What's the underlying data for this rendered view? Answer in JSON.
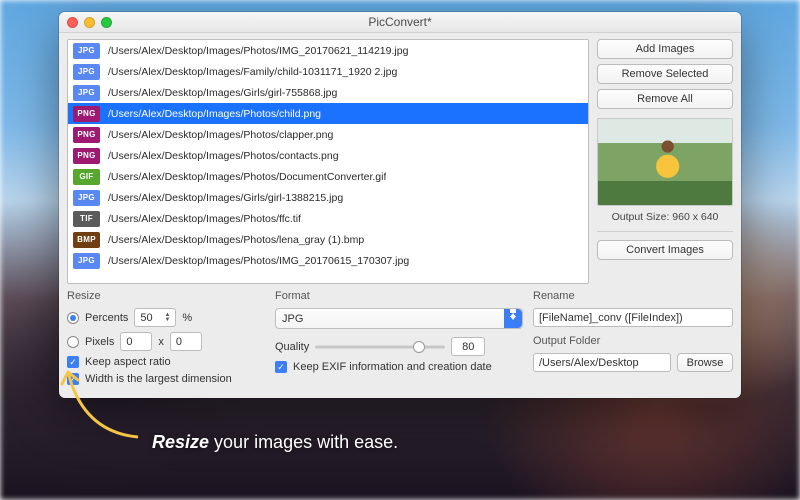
{
  "window": {
    "title": "PicConvert*"
  },
  "files": [
    {
      "type": "JPG",
      "badge": "b-jpg",
      "path": "/Users/Alex/Desktop/Images/Photos/IMG_20170621_114219.jpg",
      "selected": false
    },
    {
      "type": "JPG",
      "badge": "b-jpg",
      "path": "/Users/Alex/Desktop/Images/Family/child-1031171_1920 2.jpg",
      "selected": false
    },
    {
      "type": "JPG",
      "badge": "b-jpg",
      "path": "/Users/Alex/Desktop/Images/Girls/girl-755868.jpg",
      "selected": false
    },
    {
      "type": "PNG",
      "badge": "b-png",
      "path": "/Users/Alex/Desktop/Images/Photos/child.png",
      "selected": true
    },
    {
      "type": "PNG",
      "badge": "b-png",
      "path": "/Users/Alex/Desktop/Images/Photos/clapper.png",
      "selected": false
    },
    {
      "type": "PNG",
      "badge": "b-png",
      "path": "/Users/Alex/Desktop/Images/Photos/contacts.png",
      "selected": false
    },
    {
      "type": "GIF",
      "badge": "b-gif",
      "path": "/Users/Alex/Desktop/Images/Photos/DocumentConverter.gif",
      "selected": false
    },
    {
      "type": "JPG",
      "badge": "b-jpg",
      "path": "/Users/Alex/Desktop/Images/Girls/girl-1388215.jpg",
      "selected": false
    },
    {
      "type": "TIF",
      "badge": "b-tif",
      "path": "/Users/Alex/Desktop/Images/Photos/ffc.tif",
      "selected": false
    },
    {
      "type": "BMP",
      "badge": "b-bmp",
      "path": "/Users/Alex/Desktop/Images/Photos/lena_gray (1).bmp",
      "selected": false
    },
    {
      "type": "JPG",
      "badge": "b-jpg",
      "path": "/Users/Alex/Desktop/Images/Photos/IMG_20170615_170307.jpg",
      "selected": false
    }
  ],
  "sidebar": {
    "add": "Add Images",
    "remove_selected": "Remove Selected",
    "remove_all": "Remove All",
    "output_size": "Output Size: 960 x 640",
    "convert": "Convert Images"
  },
  "resize": {
    "heading": "Resize",
    "percents_label": "Percents",
    "percents_value": "50",
    "percent_suffix": "%",
    "pixels_label": "Pixels",
    "pixels_w": "0",
    "pixels_x": "x",
    "pixels_h": "0",
    "keep_ratio": "Keep aspect ratio",
    "width_largest": "Width is the largest dimension"
  },
  "format": {
    "heading": "Format",
    "selected": "JPG",
    "quality_label": "Quality",
    "quality_value": "80",
    "keep_exif": "Keep EXIF information and creation date"
  },
  "rename": {
    "heading": "Rename",
    "pattern": "[FileName]_conv ([FileIndex])"
  },
  "output": {
    "heading": "Output Folder",
    "path": "/Users/Alex/Desktop",
    "browse": "Browse"
  },
  "caption": {
    "emph": "Resize",
    "rest": " your images with ease."
  }
}
